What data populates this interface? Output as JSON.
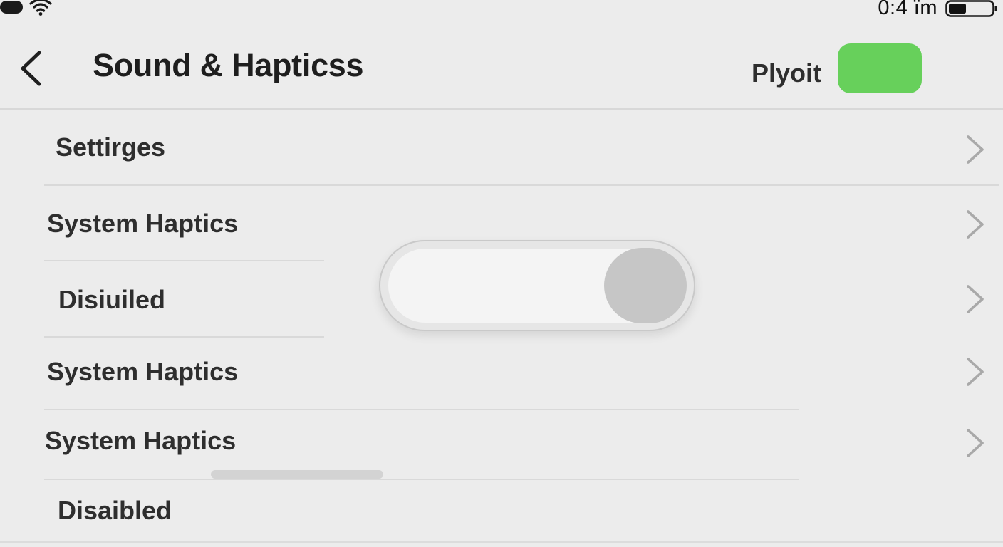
{
  "status_bar": {
    "time": "0:4 ïm",
    "battery_level": 0.4,
    "icons": [
      "cellular-pill-icon",
      "wifi-icon",
      "battery-icon"
    ]
  },
  "nav": {
    "back_icon": "chevron-left-icon",
    "title": "Sound & Hapticss",
    "play_label": "Plyoit",
    "play_toggle_on": true
  },
  "rows": [
    {
      "label": "Settirges",
      "chevron": true
    },
    {
      "label": "System Haptics",
      "chevron": true
    },
    {
      "label": "Disiuiled",
      "chevron": true
    },
    {
      "label": "System Haptics",
      "chevron": true
    },
    {
      "label": "System Haptics",
      "chevron": true
    },
    {
      "label": "Disaibled",
      "chevron": false
    }
  ],
  "big_switch": {
    "on": false
  },
  "colors": {
    "background": "#ececec",
    "toggle_on": "#67d05b",
    "switch_knob": "#c6c6c6",
    "chevron": "#a9a9a9",
    "separator": "#d9d9d9"
  }
}
